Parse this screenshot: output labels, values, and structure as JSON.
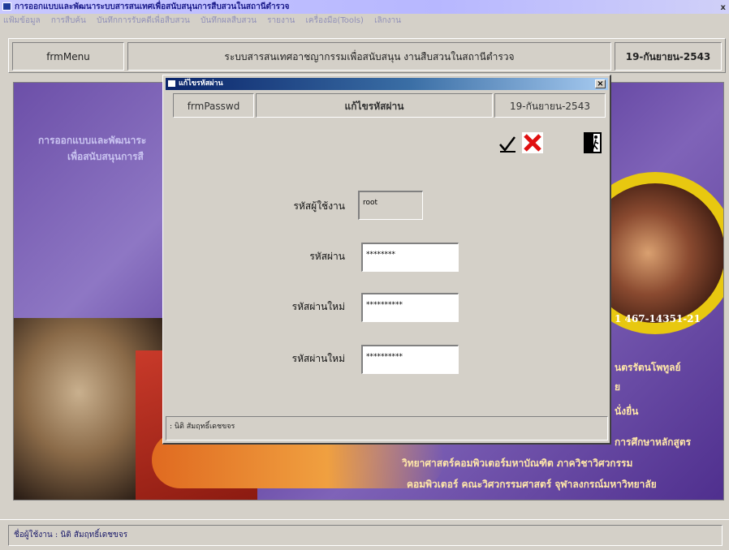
{
  "app": {
    "title": "การออกแบบและพัฒนาระบบสารสนเทศเพื่อสนับสนุนการสืบสวนในสถานีตำรวจ",
    "close_glyph": "x"
  },
  "menu": {
    "items": [
      {
        "label": "แฟ้มข้อมูล"
      },
      {
        "label": "การสืบค้น"
      },
      {
        "label": "บันทึกการรับคดีเพื่อสืบสวน"
      },
      {
        "label": "บันทึกผลสืบสวน"
      },
      {
        "label": "รายงาน"
      },
      {
        "label": "เครื่องมือ(Tools)"
      },
      {
        "label": "เลิกงาน"
      }
    ]
  },
  "header": {
    "form_name": "frmMenu",
    "title": "ระบบสารสนเทศอาชญากรรมเพื่อสนับสนุน งานสืบสวนในสถานีตำรวจ",
    "date": "19-กันยายน-2543"
  },
  "background": {
    "left_line1": "การออกแบบและพัฒนาระ",
    "left_line2": "เพื่อสนับสนุนการสื",
    "phone": "1 467-14351-21",
    "right_line1": "นตรรัตนโพทูลย์",
    "right_line2": "ย",
    "right_line3": "นั่งยื่น",
    "right_line4": "การศึกษาหลักสูตร",
    "right_line5": "วิทยาศาสตร์คอมพิวเตอร์มหาบัณฑิต ภาควิชาวิศวกรรม",
    "right_line6": "คอมพิวเตอร์ คณะวิศวกรรมศาสตร์ จุฬาลงกรณ์มหาวิทยาลัย"
  },
  "dialog": {
    "title": "แก้ไขรหัสผ่าน",
    "form_name": "frmPasswd",
    "heading": "แก้ไขรหัสผ่าน",
    "date": "19-กันยายน-2543",
    "fields": [
      {
        "label": "รหัสผู้ใช้งาน",
        "value": "root"
      },
      {
        "label": "รหัสผ่าน",
        "value": "********"
      },
      {
        "label": "รหัสผ่านใหม่",
        "value": "**********"
      },
      {
        "label": "รหัสผ่านใหม่",
        "value": "**********"
      }
    ],
    "status": ": นิติ สัมฤทธิ์เดชขจร"
  },
  "statusbar": {
    "text": "ชื่อผู้ใช้งาน : นิติ สัมฤทธิ์เดชขจร"
  },
  "colors": {
    "confirm": "#000000",
    "cancel": "#e01010",
    "exit_bg": "#000000"
  },
  "icons": {
    "confirm": "checkmark-icon",
    "cancel": "red-x-icon",
    "exit": "exit-door-icon"
  }
}
